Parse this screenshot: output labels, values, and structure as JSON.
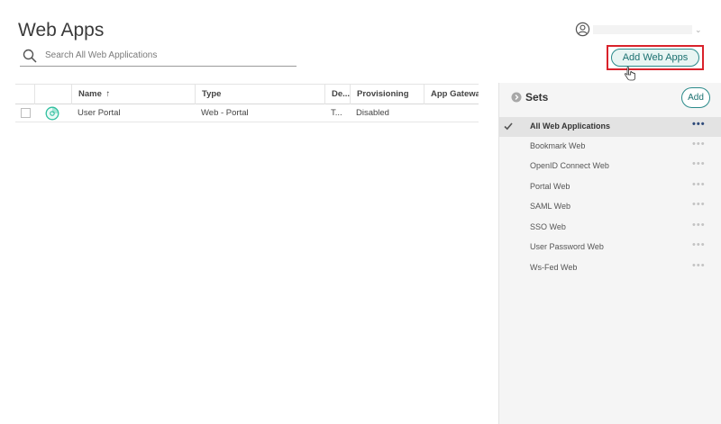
{
  "header": {
    "title": "Web Apps",
    "search_placeholder": "Search All Web Applications",
    "add_button_label": "Add Web Apps"
  },
  "table": {
    "columns": [
      "",
      "",
      "Name",
      "Type",
      "De...",
      "Provisioning",
      "App Gateway"
    ],
    "sort_indicator": "↑",
    "rows": [
      {
        "name": "User Portal",
        "type": "Web - Portal",
        "description": "T...",
        "provisioning": "Disabled",
        "app_gateway": ""
      }
    ]
  },
  "sets": {
    "title": "Sets",
    "add_label": "Add",
    "more_glyph": "•••",
    "items": [
      {
        "label": "All Web Applications",
        "active": true
      },
      {
        "label": "Bookmark Web",
        "active": false
      },
      {
        "label": "OpenID Connect Web",
        "active": false
      },
      {
        "label": "Portal Web",
        "active": false
      },
      {
        "label": "SAML Web",
        "active": false
      },
      {
        "label": "SSO Web",
        "active": false
      },
      {
        "label": "User Password Web",
        "active": false
      },
      {
        "label": "Ws-Fed Web",
        "active": false
      }
    ]
  },
  "colors": {
    "accent": "#1a7070",
    "highlight_border": "#d9222b",
    "panel_bg": "#f5f5f5"
  },
  "icons": {
    "search": "search-icon",
    "user": "user-circle-icon",
    "chevron": "chevron-down-icon",
    "app": "portal-app-icon",
    "sets_toggle": "chevron-right-circle-icon",
    "check": "checkmark-icon",
    "more": "more-horizontal-icon",
    "cursor": "hand-cursor-icon"
  }
}
